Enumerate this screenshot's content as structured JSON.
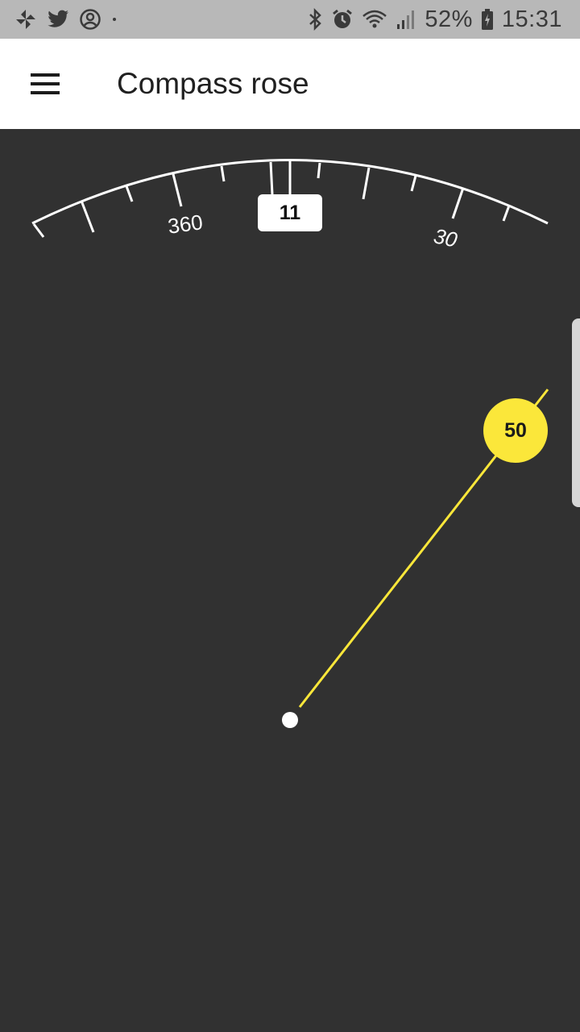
{
  "status_bar": {
    "icons_left": [
      "pinwheel-icon",
      "twitter-icon",
      "account-circle-icon",
      "dot-icon"
    ],
    "icons_right": [
      "bluetooth-icon",
      "alarm-icon",
      "wifi-icon",
      "signal-icon"
    ],
    "battery_percent": "52%",
    "battery_icon": "battery-charging-icon",
    "time": "15:31"
  },
  "app_bar": {
    "menu_icon": "menu-icon",
    "title": "Compass rose"
  },
  "compass": {
    "current_heading": "11",
    "scale_labels": [
      "360",
      "30"
    ],
    "bearing_value": "50",
    "colors": {
      "background": "#313131",
      "scale": "#ffffff",
      "bearing": "#fbe73a"
    }
  }
}
